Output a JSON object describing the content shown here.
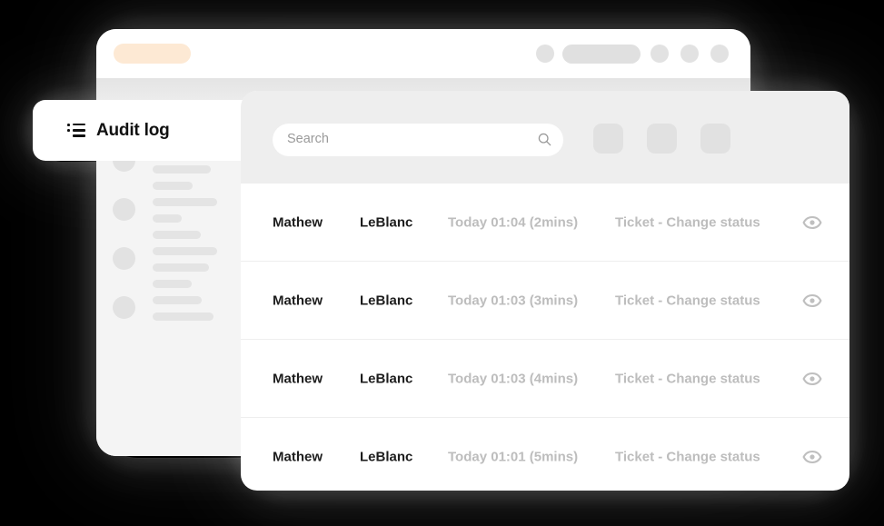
{
  "window": {
    "url_pill": "url-bar-placeholder",
    "toolbar_icons": [
      "circle",
      "pill",
      "circle",
      "circle",
      "circle"
    ]
  },
  "audit_card": {
    "icon": "list-icon",
    "title": "Audit log"
  },
  "table": {
    "search": {
      "placeholder": "Search",
      "value": "",
      "icon": "search-icon"
    },
    "header_buttons": [
      "filter-button",
      "sort-button",
      "export-button"
    ],
    "row_action_icon": "eye-icon",
    "rows": [
      {
        "first_name": "Mathew",
        "last_name": "LeBlanc",
        "time": "Today 01:04 (2mins)",
        "action": "Ticket - Change status"
      },
      {
        "first_name": "Mathew",
        "last_name": "LeBlanc",
        "time": "Today 01:03 (3mins)",
        "action": "Ticket - Change status"
      },
      {
        "first_name": "Mathew",
        "last_name": "LeBlanc",
        "time": "Today 01:03 (4mins)",
        "action": "Ticket - Change status"
      },
      {
        "first_name": "Mathew",
        "last_name": "LeBlanc",
        "time": "Today 01:01 (5mins)",
        "action": "Ticket - Change status"
      }
    ]
  },
  "colors": {
    "background": "#000000",
    "panel": "#ffffff",
    "table_header": "#eeeeee",
    "accent_pill": "#fde9d4",
    "skeleton": "#e4e4e4",
    "muted_text": "#bdbdbd",
    "primary_text": "#1d1d1d"
  }
}
